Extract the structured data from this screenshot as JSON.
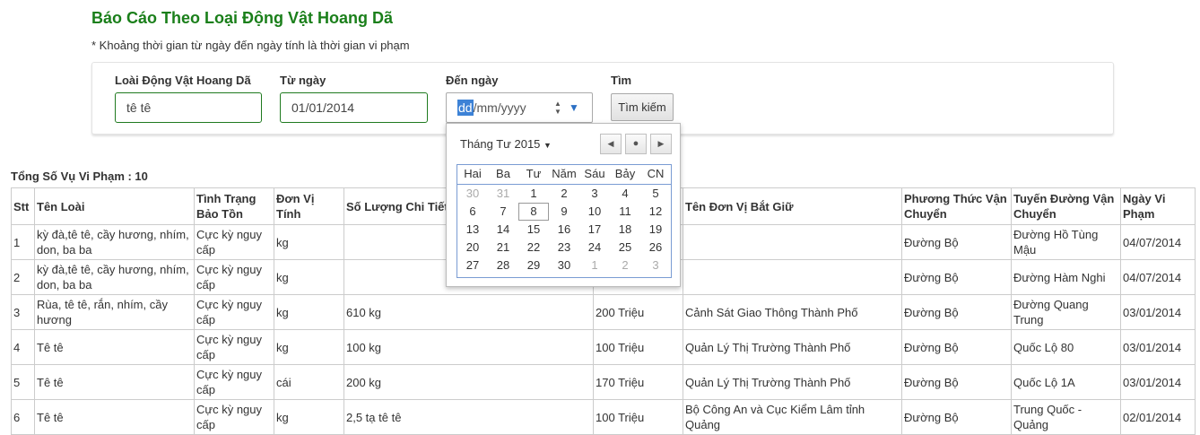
{
  "page": {
    "title": "Báo Cáo Theo Loại Động Vật Hoang Dã",
    "note": "* Khoảng thời gian từ ngày đến ngày tính là thời gian vi phạm"
  },
  "filters": {
    "species_label": "Loài Động Vật Hoang Dã",
    "species_value": "tê tê",
    "from_label": "Từ ngày",
    "from_value": "01/01/2014",
    "to_label": "Đến ngày",
    "to_seg_day": "dd",
    "to_seg_rest": "/mm/yyyy",
    "search_label": "Tìm",
    "search_button": "Tìm kiếm"
  },
  "summary": {
    "total_text": "Tổng Số Vụ Vi Phạm : 10"
  },
  "calendar": {
    "month_label": "Tháng Tư 2015",
    "weekdays": [
      "Hai",
      "Ba",
      "Tư",
      "Năm",
      "Sáu",
      "Bảy",
      "CN"
    ],
    "weeks": [
      [
        {
          "d": "30",
          "o": true
        },
        {
          "d": "31",
          "o": true
        },
        {
          "d": "1"
        },
        {
          "d": "2"
        },
        {
          "d": "3"
        },
        {
          "d": "4"
        },
        {
          "d": "5"
        }
      ],
      [
        {
          "d": "6"
        },
        {
          "d": "7"
        },
        {
          "d": "8",
          "t": true
        },
        {
          "d": "9"
        },
        {
          "d": "10"
        },
        {
          "d": "11"
        },
        {
          "d": "12"
        }
      ],
      [
        {
          "d": "13"
        },
        {
          "d": "14"
        },
        {
          "d": "15"
        },
        {
          "d": "16"
        },
        {
          "d": "17"
        },
        {
          "d": "18"
        },
        {
          "d": "19"
        }
      ],
      [
        {
          "d": "20"
        },
        {
          "d": "21"
        },
        {
          "d": "22"
        },
        {
          "d": "23"
        },
        {
          "d": "24"
        },
        {
          "d": "25"
        },
        {
          "d": "26"
        }
      ],
      [
        {
          "d": "27"
        },
        {
          "d": "28"
        },
        {
          "d": "29"
        },
        {
          "d": "30"
        },
        {
          "d": "1",
          "o": true
        },
        {
          "d": "2",
          "o": true
        },
        {
          "d": "3",
          "o": true
        }
      ]
    ]
  },
  "table": {
    "headers": [
      "Stt",
      "Tên Loài",
      "Tình Trạng Bảo Tồn",
      "Đơn Vị Tính",
      "Số Lượng Chi Tiết",
      "",
      "Tên Đơn Vị Bắt Giữ",
      "Phương Thức Vận Chuyển",
      "Tuyến Đường Vận Chuyển",
      "Ngày Vi Phạm"
    ],
    "rows": [
      [
        "1",
        "kỳ đà,tê tê, cầy hương, nhím, don, ba ba",
        "Cực kỳ nguy cấp",
        "kg",
        "",
        "",
        "",
        "Đường Bộ",
        "Đường Hồ Tùng Mậu",
        "04/07/2014"
      ],
      [
        "2",
        "kỳ đà,tê tê, cầy hương, nhím, don, ba ba",
        "Cực kỳ nguy cấp",
        "kg",
        "",
        "",
        "",
        "Đường Bộ",
        "Đường Hàm Nghi",
        "04/07/2014"
      ],
      [
        "3",
        "Rùa, tê tê, rắn, nhím, cầy hương",
        "Cực kỳ nguy cấp",
        "kg",
        "610 kg",
        "200 Triệu",
        "Cảnh Sát Giao Thông Thành Phố",
        "Đường Bộ",
        "Đường Quang Trung",
        "03/01/2014"
      ],
      [
        "4",
        "Tê tê",
        "Cực kỳ nguy cấp",
        "kg",
        "100 kg",
        "100 Triệu",
        "Quản Lý Thị Trường Thành Phố",
        "Đường Bộ",
        "Quốc Lộ 80",
        "03/01/2014"
      ],
      [
        "5",
        "Tê tê",
        "Cực kỳ nguy cấp",
        "cái",
        "200 kg",
        "170 Triệu",
        "Quản Lý Thị Trường Thành Phố",
        "Đường Bộ",
        "Quốc Lộ 1A",
        "03/01/2014"
      ],
      [
        "6",
        "Tê tê",
        "Cực kỳ nguy cấp",
        "kg",
        "2,5 tạ tê tê",
        "100 Triệu",
        "Bộ Công An và Cục Kiểm Lâm tỉnh Quảng",
        "Đường Bộ",
        "Trung Quốc - Quảng",
        "02/01/2014"
      ]
    ]
  },
  "colors": {
    "title_green": "#1a7f1a",
    "input_border_green": "#1f7a1f",
    "date_highlight": "#3d82d6"
  }
}
